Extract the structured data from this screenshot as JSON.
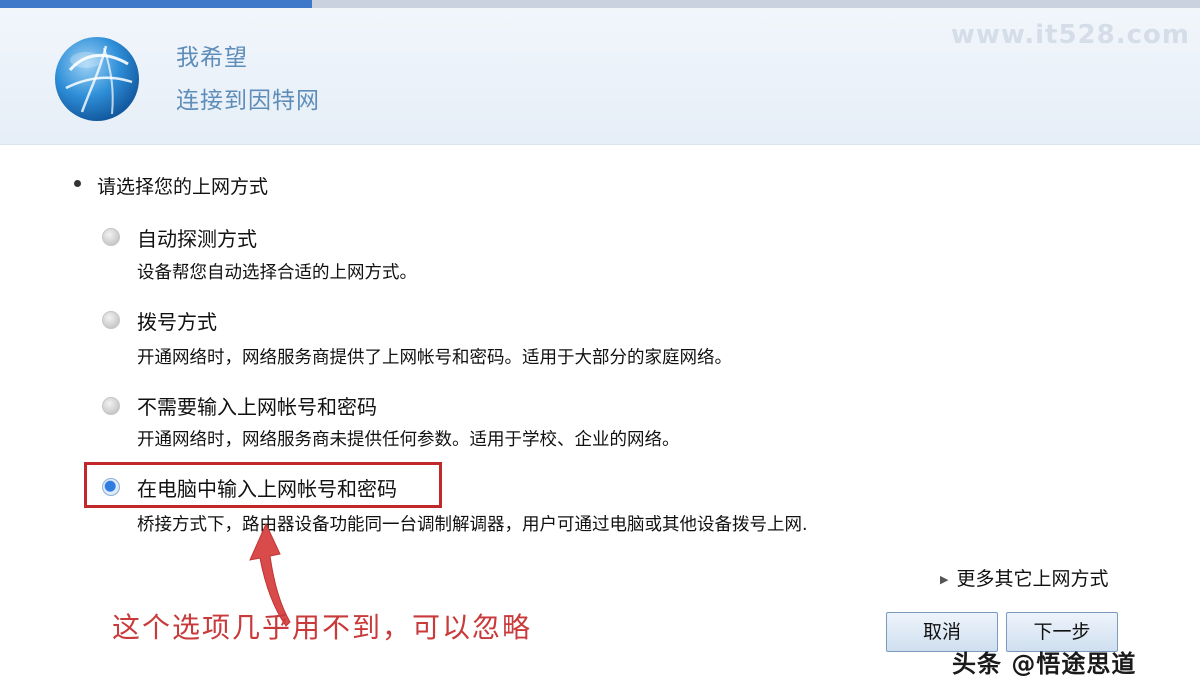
{
  "progress": {
    "fraction": 0.26
  },
  "header": {
    "title": "我希望",
    "subtitle": "连接到因特网",
    "watermark": "www.it528.com",
    "icon": "globe-icon"
  },
  "prompt": "请选择您的上网方式",
  "options": [
    {
      "label": "自动探测方式",
      "description": "设备帮您自动选择合适的上网方式。",
      "selected": false
    },
    {
      "label": "拨号方式",
      "description": "开通网络时，网络服务商提供了上网帐号和密码。适用于大部分的家庭网络。",
      "selected": false
    },
    {
      "label": "不需要输入上网帐号和密码",
      "description": "开通网络时，网络服务商未提供任何参数。适用于学校、企业的网络。",
      "selected": false
    },
    {
      "label": "在电脑中输入上网帐号和密码",
      "description": "桥接方式下，路由器设备功能同一台调制解调器，用户可通过电脑或其他设备拨号上网.",
      "selected": true
    }
  ],
  "annotation": "这个选项几乎用不到，可以忽略",
  "more_link": "更多其它上网方式",
  "buttons": {
    "cancel": "取消",
    "next": "下一步"
  },
  "footer_mark": "头条 @悟途思道",
  "colors": {
    "accent": "#3e78c8",
    "highlight": "#c0282a",
    "annotation": "#c93a3a"
  }
}
